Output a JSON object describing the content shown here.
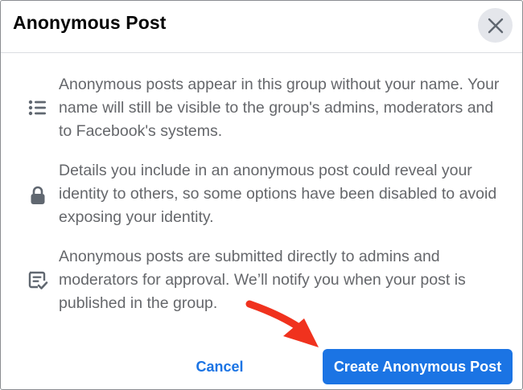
{
  "dialog": {
    "title": "Anonymous Post",
    "close_icon": "close-icon"
  },
  "rows": [
    {
      "icon": "list-icon",
      "text": "Anonymous posts appear in this group without your name. Your name will still be visible to the group's admins, moderators and to Facebook's systems."
    },
    {
      "icon": "lock-icon",
      "text": "Details you include in an anonymous post could reveal your identity to others, so some options have been disabled to avoid exposing your identity."
    },
    {
      "icon": "approval-icon",
      "text": "Anonymous posts are submitted directly to admins and moderators for approval. We’ll notify you when your post is published in the group."
    }
  ],
  "footer": {
    "cancel_label": "Cancel",
    "create_label": "Create Anonymous Post"
  },
  "colors": {
    "accent": "#1b74e4",
    "annotation_arrow": "#f0321e",
    "body_text": "#65676b",
    "icon": "#606770"
  }
}
